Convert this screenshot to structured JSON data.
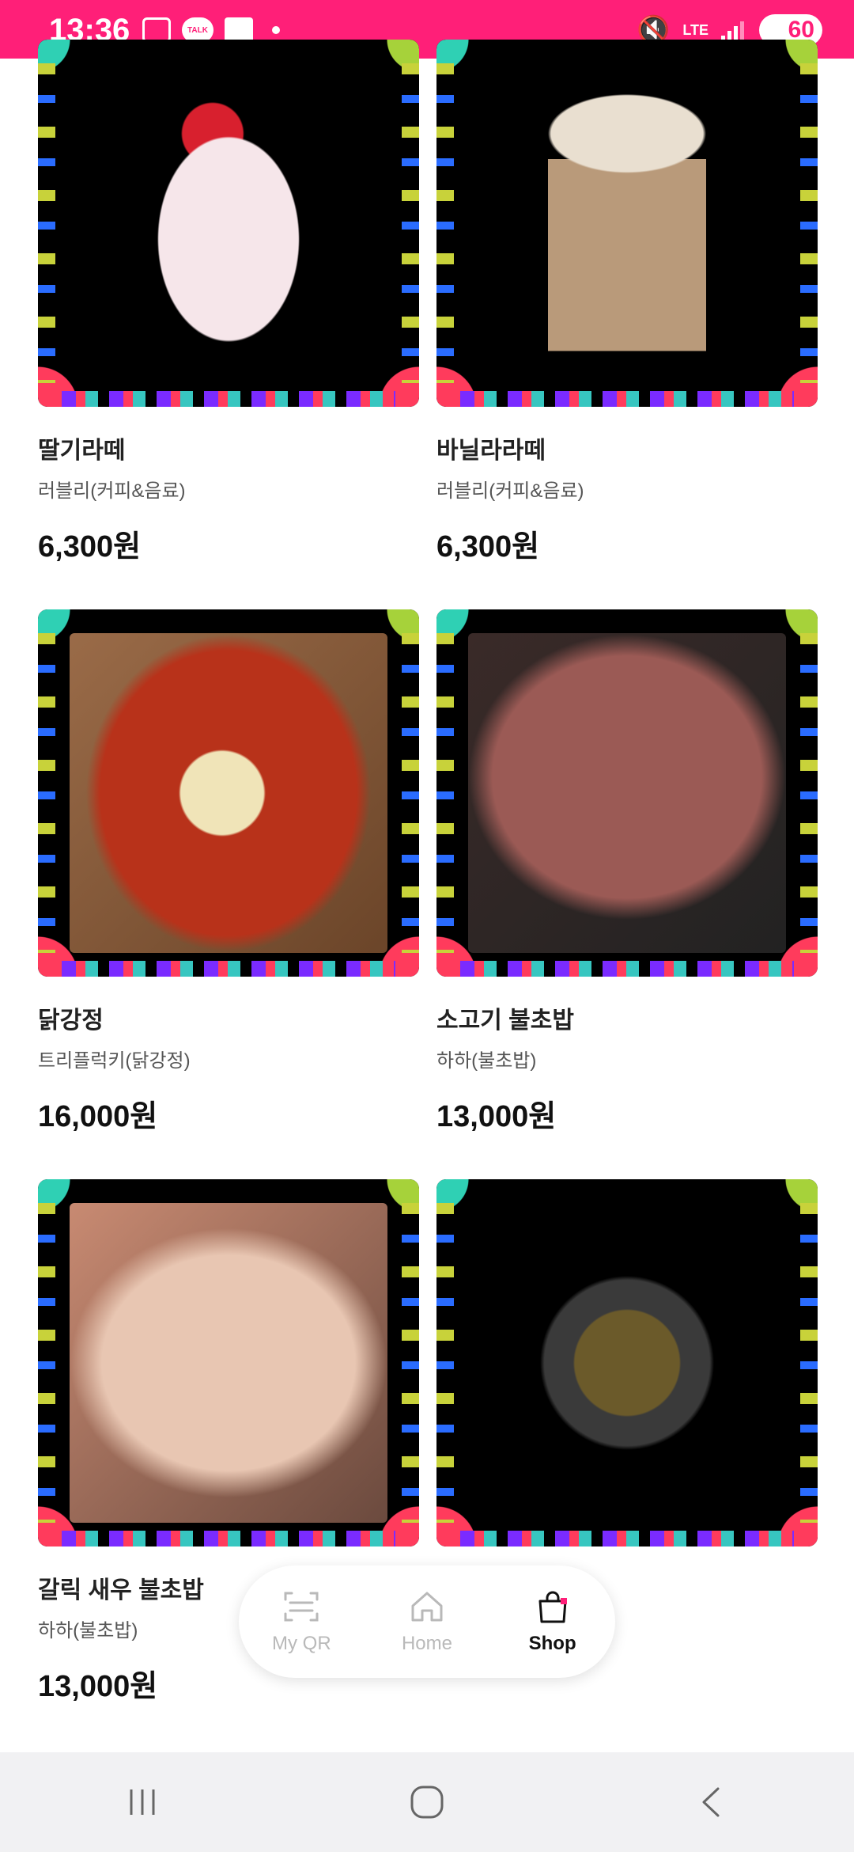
{
  "status_bar": {
    "time": "13:36",
    "talk_label": "TALK",
    "network": "LTE",
    "battery": "60"
  },
  "products": [
    {
      "name": "딸기라떼",
      "store": "러블리(커피&음료)",
      "price": "6,300원",
      "image": "strawberry-latte-photo"
    },
    {
      "name": "바닐라라떼",
      "store": "러블리(커피&음료)",
      "price": "6,300원",
      "image": "vanilla-latte-photo"
    },
    {
      "name": "닭강정",
      "store": "트리플럭키(닭강정)",
      "price": "16,000원",
      "image": "fried-chicken-photo"
    },
    {
      "name": "소고기 불초밥",
      "store": "하하(불초밥)",
      "price": "13,000원",
      "image": "beef-sushi-photo"
    },
    {
      "name": "갈릭 새우 불초밥",
      "store": "하하(불초밥)",
      "price": "13,000원",
      "image": "shrimp-sushi-photo"
    },
    {
      "name": "",
      "store": "",
      "price": "",
      "image": "noodle-bowl-photo"
    }
  ],
  "bottom_nav": {
    "items": [
      {
        "label": "My QR",
        "icon": "qr-scan-icon"
      },
      {
        "label": "Home",
        "icon": "home-icon"
      },
      {
        "label": "Shop",
        "icon": "shopping-bag-icon",
        "active": true
      }
    ]
  },
  "colors": {
    "status_bar": "#ff1f78",
    "nav_active": "#111111",
    "nav_inactive": "#b9b9b9"
  }
}
